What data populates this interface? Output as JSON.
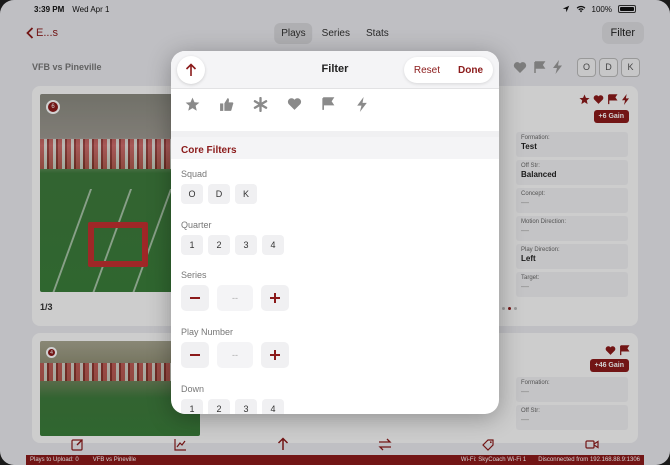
{
  "status_bar": {
    "time": "3:39 PM",
    "date": "Wed Apr 1",
    "battery": "100%"
  },
  "nav": {
    "back_label": "E...s",
    "tabs": [
      {
        "label": "Plays",
        "active": true
      },
      {
        "label": "Series",
        "active": false
      },
      {
        "label": "Stats",
        "active": false
      }
    ],
    "filter_label": "Filter"
  },
  "toolbar": {
    "game_title": "VFB vs Pineville",
    "odk": [
      "O",
      "D",
      "K"
    ]
  },
  "cards": [
    {
      "play_number": "6",
      "pager": "1/3",
      "gain": "+6 Gain",
      "icons": [
        "star-icon",
        "heart-icon",
        "flag-icon",
        "bolt-icon"
      ],
      "fields": [
        {
          "key": "Formation:",
          "value": "Test"
        },
        {
          "key": "Off Str:",
          "value": "Balanced"
        },
        {
          "key": "Concept:",
          "value": "—"
        },
        {
          "key": "Motion Direction:",
          "value": "—"
        },
        {
          "key": "Play Direction:",
          "value": "Left"
        },
        {
          "key": "Target:",
          "value": "—"
        }
      ]
    },
    {
      "play_number": "4",
      "gain": "+46 Gain",
      "icons": [
        "heart-icon",
        "flag-icon"
      ],
      "fields": [
        {
          "key": "Formation:",
          "value": "—"
        },
        {
          "key": "Off Str:",
          "value": "—"
        }
      ]
    }
  ],
  "footer": {
    "plays_to_upload": "Plays to Upload: 0",
    "game": "VFB vs Pineville",
    "wifi": "Wi-Fi: SkyCoach Wi-Fi 1",
    "connection": "Disconnected from 192.168.88.9:1306"
  },
  "filter_popover": {
    "title": "Filter",
    "reset_label": "Reset",
    "done_label": "Done",
    "quick_icons": [
      "star-icon",
      "thumbs-up-icon",
      "asterisk-icon",
      "heart-icon",
      "flag-icon",
      "bolt-icon"
    ],
    "section_title": "Core Filters",
    "squad": {
      "label": "Squad",
      "options": [
        "O",
        "D",
        "K"
      ]
    },
    "quarter": {
      "label": "Quarter",
      "options": [
        "1",
        "2",
        "3",
        "4"
      ]
    },
    "series": {
      "label": "Series",
      "value": "--"
    },
    "play_number": {
      "label": "Play Number",
      "value": "--"
    },
    "down": {
      "label": "Down",
      "options": [
        "1",
        "2",
        "3",
        "4"
      ]
    }
  },
  "colors": {
    "accent": "#8b1a1a",
    "background": "#e9e9ee",
    "surface": "#fafafa"
  }
}
